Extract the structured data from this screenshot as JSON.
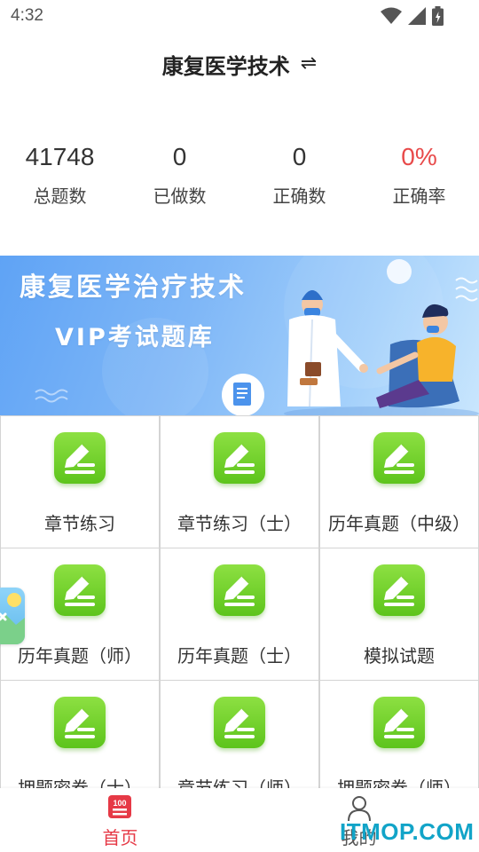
{
  "status_bar": {
    "time": "4:32",
    "icons": [
      "wifi-icon",
      "signal-icon",
      "battery-icon"
    ]
  },
  "header": {
    "title": "康复医学技术",
    "switch_icon": "⇌"
  },
  "stats": [
    {
      "value": "41748",
      "label": "总题数"
    },
    {
      "value": "0",
      "label": "已做数"
    },
    {
      "value": "0",
      "label": "正确数"
    },
    {
      "value": "0%",
      "label": "正确率"
    }
  ],
  "banner": {
    "line1": "康复医学治疗技术",
    "line2": "VIP考试题库"
  },
  "grid": [
    {
      "label": "章节练习"
    },
    {
      "label": "章节练习（士）"
    },
    {
      "label": "历年真题（中级）"
    },
    {
      "label": "历年真题（师）"
    },
    {
      "label": "历年真题（士）"
    },
    {
      "label": "模拟试题"
    },
    {
      "label": "押题密卷（士）"
    },
    {
      "label": "章节练习（师）"
    },
    {
      "label": "押题密卷（师）"
    }
  ],
  "bottom_nav": {
    "home_badge": "100",
    "home_label": "首页",
    "me_label": "我的"
  },
  "watermark": "ITMOP.COM",
  "colors": {
    "accent_red": "#e63946",
    "rate_red": "#e84a4a",
    "icon_green": "#6fd027",
    "banner_blue": "#5fa3f5",
    "watermark_blue": "#12a4c8"
  }
}
